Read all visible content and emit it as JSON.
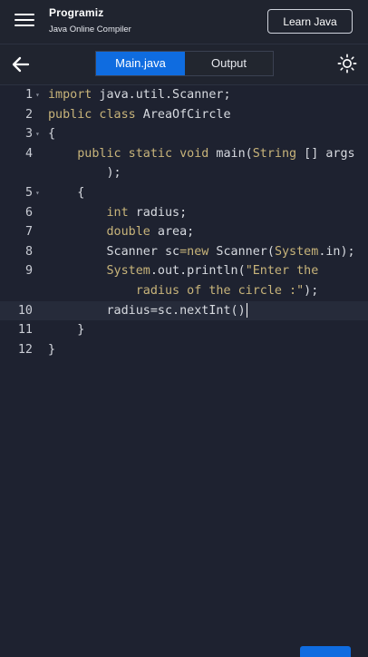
{
  "header": {
    "brand_name": "Programiz",
    "subtitle": "Java Online Compiler",
    "learn_button": "Learn Java"
  },
  "toolbar": {
    "tabs": [
      {
        "label": "Main.java",
        "active": true
      },
      {
        "label": "Output",
        "active": false
      }
    ]
  },
  "editor": {
    "current_line": 10,
    "line_numbers": [
      "1",
      "2",
      "3",
      "4",
      "5",
      "6",
      "7",
      "8",
      "9",
      "10",
      "11",
      "12"
    ],
    "code": {
      "l1_a": "import",
      "l1_b": " java.util.Scanner;",
      "l2_a": "public class",
      "l2_b": " AreaOfCircle",
      "l3": "{",
      "l4_a": "    public static void",
      "l4_b": " main(",
      "l4_c": "String",
      "l4_d": " [] args",
      "l4_wrap": "        );",
      "l5": "    {",
      "l6_a": "        int",
      "l6_b": " radius;",
      "l7_a": "        double",
      "l7_b": " area;",
      "l8_a": "        Scanner sc",
      "l8_b": "=new",
      "l8_c": " Scanner(",
      "l8_d": "System",
      "l8_e": ".in);",
      "l9_a": "        System",
      "l9_b": ".out.println(",
      "l9_c": "\"Enter the",
      "l9_wrap_a": "            radius of the circle :\"",
      "l9_wrap_b": ");",
      "l10": "        radius=sc.nextInt()",
      "l11": "    }",
      "l12": "}"
    }
  },
  "colors": {
    "background": "#1e2230",
    "accent": "#0f6ce0",
    "keyword": "#c8b47a",
    "text": "#d7dae0"
  },
  "icons": {
    "menu": "hamburger-menu-icon",
    "back": "arrow-left-icon",
    "theme": "sun-icon",
    "fold": "fold-caret-icon"
  }
}
